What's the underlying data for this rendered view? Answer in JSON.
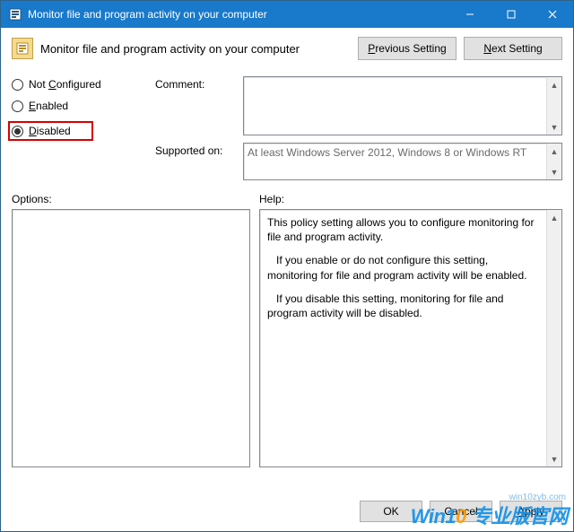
{
  "titlebar": {
    "title": "Monitor file and program activity on your computer"
  },
  "header": {
    "title": "Monitor file and program activity on your computer",
    "prev_prefix": "P",
    "prev_rest": "revious Setting",
    "next_prefix": "N",
    "next_rest": "ext Setting"
  },
  "radios": {
    "not_configured_prefix": "C",
    "not_configured_label": "Not ",
    "not_configured_rest": "onfigured",
    "enabled_prefix": "E",
    "enabled_rest": "nabled",
    "disabled_prefix": "D",
    "disabled_rest": "isabled",
    "selected": "disabled"
  },
  "fields": {
    "comment_label": "Comment:",
    "comment_value": "",
    "supported_label": "Supported on:",
    "supported_value": "At least Windows Server 2012, Windows 8 or Windows RT"
  },
  "panes": {
    "options_label": "Options:",
    "help_label": "Help:"
  },
  "help": {
    "p1": "This policy setting allows you to configure monitoring for file and program activity.",
    "p2": "If you enable or do not configure this setting, monitoring for file and program activity will be enabled.",
    "p3": "If you disable this setting, monitoring for file and program activity will be disabled."
  },
  "buttons": {
    "ok": "OK",
    "cancel": "Cancel",
    "apply_prefix": "A",
    "apply_rest": "pply"
  },
  "watermark": {
    "url": "win10zyb.com",
    "brand_pre": "Win1",
    "brand_o": "0",
    "brand_post": " 专业版官网"
  }
}
